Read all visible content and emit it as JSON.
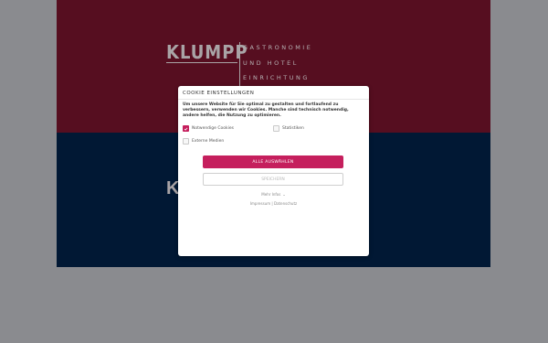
{
  "logo": {
    "wordmark": "KLUMPP",
    "tagline": [
      "GASTRONOMIE",
      "UND HOTEL",
      "EINRICHTUNG"
    ],
    "wordmark_partial": "K"
  },
  "cookie_dialog": {
    "title": "COOKIE EINSTELLUNGEN",
    "description": "Um unsere Website für Sie optimal zu gestalten und fortlaufend zu verbessern, verwenden wir Cookies. Manche sind technisch notwendig, andere helfen, die Nutzung zu optimieren.",
    "options": [
      {
        "label": "Notwendige Cookies",
        "checked": true
      },
      {
        "label": "Statistiken",
        "checked": false
      },
      {
        "label": "Externe Medien",
        "checked": false
      }
    ],
    "accept_all_label": "ALLE AUSWÄHLEN",
    "save_label": "SPEICHERN",
    "more_info_label": "Mehr Infos",
    "imprint_label": "Impressum",
    "link_separator": "|",
    "privacy_label": "Datenschutz"
  },
  "colors": {
    "background": "#8a8b8f",
    "top_panel": "#560e20",
    "bottom_panel": "#011834",
    "accent": "#c51f5d"
  }
}
